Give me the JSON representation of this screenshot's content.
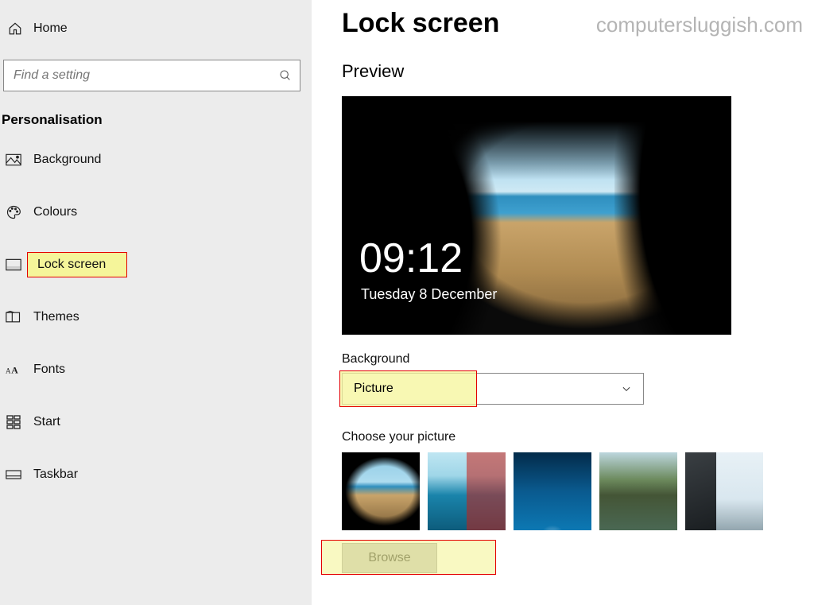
{
  "watermark": "computersluggish.com",
  "sidebar": {
    "home_label": "Home",
    "search_placeholder": "Find a setting",
    "category": "Personalisation",
    "items": [
      {
        "label": "Background"
      },
      {
        "label": "Colours"
      },
      {
        "label": "Lock screen",
        "selected": true
      },
      {
        "label": "Themes"
      },
      {
        "label": "Fonts"
      },
      {
        "label": "Start"
      },
      {
        "label": "Taskbar"
      }
    ]
  },
  "main": {
    "title": "Lock screen",
    "preview_label": "Preview",
    "clock": "09:12",
    "date": "Tuesday 8 December",
    "background_label": "Background",
    "background_value": "Picture",
    "choose_label": "Choose your picture",
    "browse_label": "Browse"
  }
}
